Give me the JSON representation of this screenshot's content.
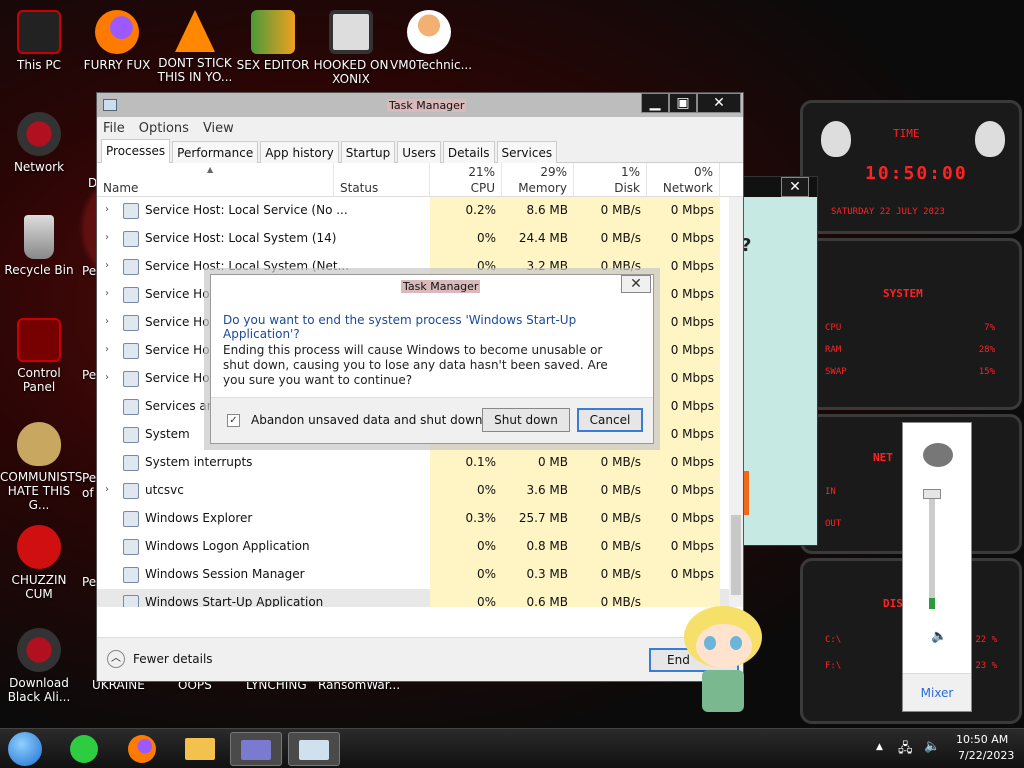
{
  "desktop": {
    "icons": [
      {
        "label": "This PC"
      },
      {
        "label": "FURRY FUX"
      },
      {
        "label": "DONT STICK THIS IN YO..."
      },
      {
        "label": "SEX EDITOR"
      },
      {
        "label": "HOOKED ON XONIX"
      },
      {
        "label": "VM0Technic..."
      },
      {
        "label": "Network"
      },
      {
        "label": "Recycle Bin"
      },
      {
        "label": "Control Panel"
      },
      {
        "label": "COMMUNISTS HATE THIS G..."
      },
      {
        "label": "CHUZZIN CUM"
      },
      {
        "label": "Download Black Ali..."
      }
    ],
    "partial_labels": [
      "Pe",
      "Pe",
      "Pe",
      "Pe",
      "of",
      "D",
      "UKRAINE",
      "OOPS",
      "LYNCHING",
      "RansomWar..."
    ]
  },
  "widget": {
    "time_title": "TIME",
    "time": "10:50:00",
    "date": "SATURDAY 22 JULY 2023",
    "system_title": "SYSTEM",
    "cpu_label": "CPU",
    "cpu_value": "7%",
    "ram_label": "RAM",
    "ram_value": "28%",
    "swap_label": "SWAP",
    "swap_value": "15%",
    "net_title": "NET",
    "in_label": "IN",
    "out_label": "OUT",
    "disk_title": "DISK",
    "c_label": "C:\\",
    "c_value": "22 %",
    "f_label": "F:\\",
    "f_value": "23 %"
  },
  "task_manager": {
    "title": "Task Manager",
    "menu": [
      "File",
      "Options",
      "View"
    ],
    "tabs": [
      "Processes",
      "Performance",
      "App history",
      "Startup",
      "Users",
      "Details",
      "Services"
    ],
    "columns": {
      "name": "Name",
      "status": "Status",
      "cpu_pct": "21%",
      "cpu": "CPU",
      "mem_pct": "29%",
      "mem": "Memory",
      "disk_pct": "1%",
      "disk": "Disk",
      "net_pct": "0%",
      "net": "Network"
    },
    "rows": [
      {
        "name": "Service Host: Local Service (No ...",
        "cpu": "0.2%",
        "mem": "8.6 MB",
        "disk": "0 MB/s",
        "net": "0 Mbps",
        "caret": "›"
      },
      {
        "name": "Service Host: Local System (14)",
        "cpu": "0%",
        "mem": "24.4 MB",
        "disk": "0 MB/s",
        "net": "0 Mbps",
        "caret": "›"
      },
      {
        "name": "Service Host: Local System (Net...",
        "cpu": "0%",
        "mem": "3.2 MB",
        "disk": "0 MB/s",
        "net": "0 Mbps",
        "caret": "›"
      },
      {
        "name": "Service Host",
        "cpu": "",
        "mem": "",
        "disk": "",
        "net": "0 Mbps",
        "caret": "›"
      },
      {
        "name": "Service Host",
        "cpu": "",
        "mem": "",
        "disk": "",
        "net": "0 Mbps",
        "caret": "›"
      },
      {
        "name": "Service Host",
        "cpu": "",
        "mem": "",
        "disk": "",
        "net": "0 Mbps",
        "caret": "›"
      },
      {
        "name": "Service Host",
        "cpu": "",
        "mem": "",
        "disk": "",
        "net": "0 Mbps",
        "caret": "›"
      },
      {
        "name": "Services and",
        "cpu": "",
        "mem": "",
        "disk": "",
        "net": "0 Mbps",
        "caret": ""
      },
      {
        "name": "System",
        "cpu": "2.0%",
        "mem": "0.1 MB",
        "disk": "0.1 MB/s",
        "net": "0 Mbps",
        "caret": ""
      },
      {
        "name": "System interrupts",
        "cpu": "0.1%",
        "mem": "0 MB",
        "disk": "0 MB/s",
        "net": "0 Mbps",
        "caret": ""
      },
      {
        "name": "utcsvc",
        "cpu": "0%",
        "mem": "3.6 MB",
        "disk": "0 MB/s",
        "net": "0 Mbps",
        "caret": "›"
      },
      {
        "name": "Windows Explorer",
        "cpu": "0.3%",
        "mem": "25.7 MB",
        "disk": "0 MB/s",
        "net": "0 Mbps",
        "caret": ""
      },
      {
        "name": "Windows Logon Application",
        "cpu": "0%",
        "mem": "0.8 MB",
        "disk": "0 MB/s",
        "net": "0 Mbps",
        "caret": ""
      },
      {
        "name": "Windows Session Manager",
        "cpu": "0%",
        "mem": "0.3 MB",
        "disk": "0 MB/s",
        "net": "0 Mbps",
        "caret": ""
      },
      {
        "name": "Windows Start-Up Application",
        "cpu": "0%",
        "mem": "0.6 MB",
        "disk": "0 MB/s",
        "net": "",
        "caret": ""
      }
    ],
    "fewer_details": "Fewer details",
    "end_button": "End"
  },
  "dialog": {
    "title": "Task Manager",
    "question": "Do you want to end the system process 'Windows Start-Up Application'?",
    "body": "Ending this process will cause Windows to become unusable or shut down, causing you to lose any data hasn't been saved. Are you sure you want to continue?",
    "checkbox_label": "Abandon unsaved data and shut down.",
    "checkbox_checked": true,
    "shutdown_button": "Shut down",
    "cancel_button": "Cancel"
  },
  "mixer": {
    "label": "Mixer",
    "volume_level": 0.1
  },
  "taskbar": {
    "time": "10:50 AM",
    "date": "7/22/2023"
  },
  "colors": {
    "accent": "#3a7bd5",
    "highlight": "#fff4c4",
    "widget_red": "#ff2222"
  }
}
